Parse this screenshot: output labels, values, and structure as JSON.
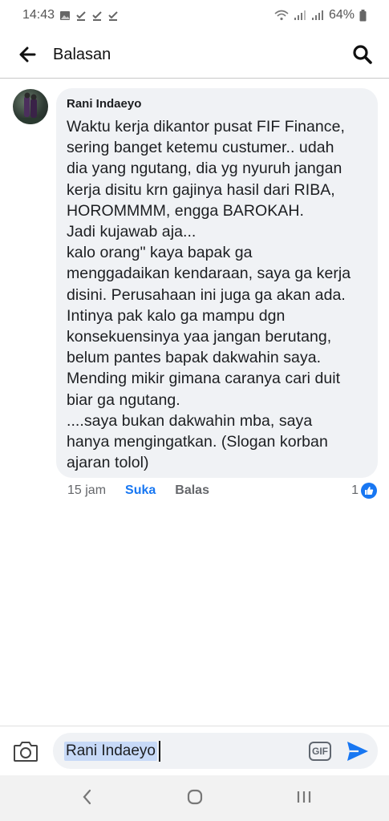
{
  "status_bar": {
    "time": "14:43",
    "battery": "64%",
    "icons": [
      "image-icon",
      "check-icon",
      "check-icon",
      "check-icon",
      "wifi-icon",
      "signal-icon",
      "signal-icon",
      "battery-icon"
    ]
  },
  "header": {
    "title": "Balasan",
    "back_icon": "arrow-left-icon",
    "search_icon": "search-icon"
  },
  "comment": {
    "author": "Rani Indaeyo",
    "text": "Waktu kerja dikantor pusat FIF Finance,\nsering banget ketemu custumer.. udah\ndia yang ngutang, dia yg nyuruh jangan\nkerja disitu krn gajinya hasil dari RIBA,\nHOROMMMM, engga BAROKAH.\nJadi kujawab aja...\nkalo orang\" kaya bapak ga\nmenggadaikan kendaraan, saya ga kerja\ndisini. Perusahaan ini juga ga akan ada.\nIntinya pak kalo ga mampu dgn\nkonsekuensinya yaa jangan berutang,\nbelum pantes bapak dakwahin saya.\nMending mikir gimana caranya cari duit\nbiar ga ngutang.\n....saya bukan dakwahin mba, saya\nhanya mengingatkan. (Slogan korban\najaran tolol)",
    "time": "15 jam",
    "like_label": "Suka",
    "reply_label": "Balas",
    "reaction_count": "1"
  },
  "composer": {
    "mention": "Rani Indaeyo",
    "gif_label": "GIF"
  },
  "colors": {
    "accent": "#1877f2",
    "bubble": "#f0f2f5",
    "mention_highlight": "#c7d9f7"
  }
}
